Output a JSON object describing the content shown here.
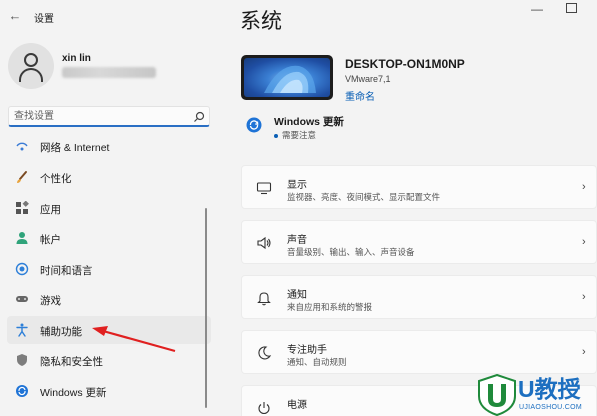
{
  "window": {
    "title": "设置",
    "back_icon": "back-arrow-icon"
  },
  "user": {
    "name": "xin lin"
  },
  "search": {
    "placeholder": "查找设置"
  },
  "sidebar": {
    "items": [
      {
        "label": "网络 & Internet",
        "icon": "network-icon"
      },
      {
        "label": "个性化",
        "icon": "brush-icon"
      },
      {
        "label": "应用",
        "icon": "apps-icon"
      },
      {
        "label": "帐户",
        "icon": "person-icon"
      },
      {
        "label": "时间和语言",
        "icon": "globe-clock-icon"
      },
      {
        "label": "游戏",
        "icon": "gamepad-icon"
      },
      {
        "label": "辅助功能",
        "icon": "accessibility-icon",
        "selected": true
      },
      {
        "label": "隐私和安全性",
        "icon": "shield-icon"
      },
      {
        "label": "Windows 更新",
        "icon": "windows-update-icon"
      }
    ]
  },
  "main": {
    "title": "系统",
    "device": {
      "name": "DESKTOP-ON1M0NP",
      "model": "VMware7,1",
      "rename": "重命名"
    },
    "update": {
      "title": "Windows 更新",
      "status": "需要注意"
    },
    "cards": [
      {
        "title": "显示",
        "desc": "监视器、亮度、夜间模式、显示配置文件",
        "icon": "monitor-icon"
      },
      {
        "title": "声音",
        "desc": "音量级别、输出、输入、声音设备",
        "icon": "speaker-icon"
      },
      {
        "title": "通知",
        "desc": "来自应用和系统的警报",
        "icon": "bell-icon"
      },
      {
        "title": "专注助手",
        "desc": "通知、自动规则",
        "icon": "moon-icon"
      },
      {
        "title": "电源",
        "desc": "",
        "icon": "power-icon"
      }
    ]
  },
  "watermark": {
    "text": "U教授",
    "sub": "UJIAOSHOU.COM"
  },
  "colors": {
    "accent": "#0a5fb5",
    "annotation_arrow": "#e02020",
    "selected_bg": "#e9e9e9"
  }
}
